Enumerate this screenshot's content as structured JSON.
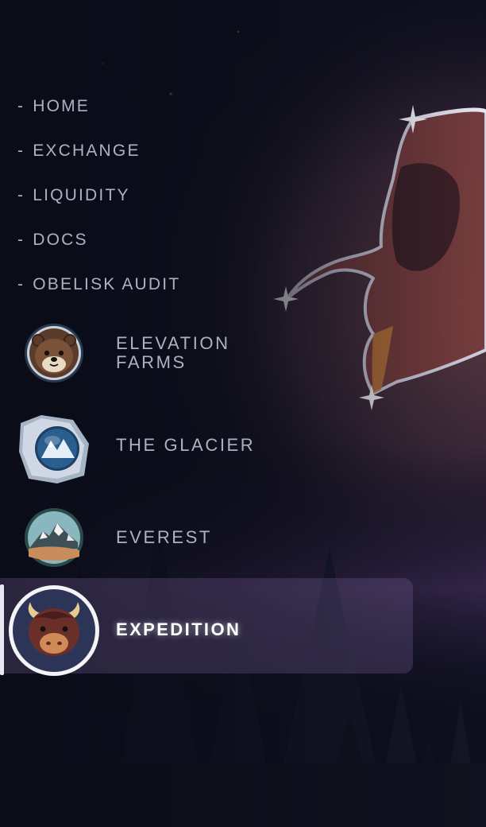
{
  "nav": {
    "links": [
      {
        "dash": "-",
        "label": "HOME"
      },
      {
        "dash": "-",
        "label": "EXCHANGE"
      },
      {
        "dash": "-",
        "label": "LIQUIDITY"
      },
      {
        "dash": "-",
        "label": "DOCS"
      },
      {
        "dash": "-",
        "label": "OBELISK AUDIT"
      }
    ]
  },
  "apps": [
    {
      "label_line1": "ELEVATION",
      "label_line2": "FARMS",
      "icon": "otter-icon"
    },
    {
      "label_line1": "THE GLACIER",
      "icon": "glacier-icon"
    },
    {
      "label_line1": "EVEREST",
      "icon": "mountain-icon"
    },
    {
      "label_line1": "EXPEDITION",
      "icon": "yak-icon",
      "active": true
    }
  ],
  "colors": {
    "background": "#0c0e1b",
    "nav_text": "#aeb1c3",
    "active_text": "#ffffff",
    "active_highlight": "#785f96"
  }
}
